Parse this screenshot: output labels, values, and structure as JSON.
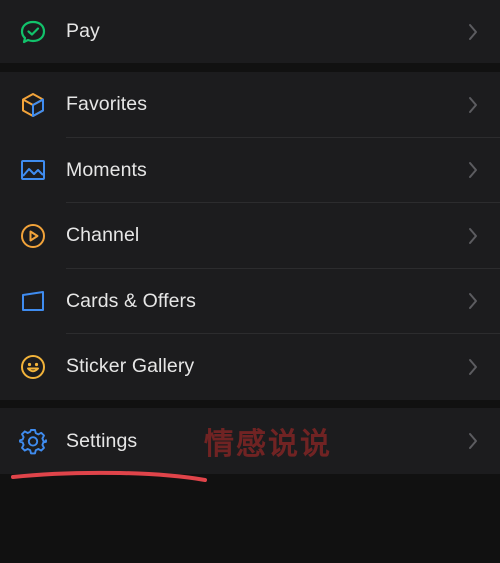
{
  "colors": {
    "background": "#111111",
    "row_background": "#1c1c1e",
    "text": "#e6e6e6",
    "chevron": "#5c5c60",
    "pay_icon": "#12c26b",
    "favorites_icon_orange": "#f2a33a",
    "favorites_icon_blue": "#3f8cf0",
    "moments_icon": "#3f8cf0",
    "channel_icon": "#f2a33a",
    "cards_icon": "#3f8cf0",
    "sticker_icon": "#f2b33a",
    "settings_icon": "#3f8cf0",
    "annotation_red": "#e0444a"
  },
  "menu": {
    "pay": {
      "label": "Pay",
      "icon": "pay-check-icon"
    },
    "favorites": {
      "label": "Favorites",
      "icon": "cube-icon"
    },
    "moments": {
      "label": "Moments",
      "icon": "image-icon"
    },
    "channel": {
      "label": "Channel",
      "icon": "play-circle-icon"
    },
    "cards": {
      "label": "Cards & Offers",
      "icon": "card-icon"
    },
    "stickers": {
      "label": "Sticker Gallery",
      "icon": "smiley-icon"
    },
    "settings": {
      "label": "Settings",
      "icon": "gear-icon"
    }
  },
  "watermark": {
    "text": "情感说说"
  }
}
